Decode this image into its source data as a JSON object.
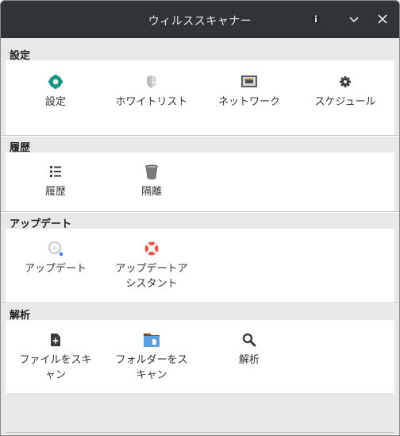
{
  "window": {
    "title": "ウィルススキャナー"
  },
  "sections": {
    "settings": {
      "title": "設定",
      "items": [
        {
          "label": "設定",
          "icon": "shield-gear-icon"
        },
        {
          "label": "ホワイトリスト",
          "icon": "whitelist-shield-icon"
        },
        {
          "label": "ネットワーク",
          "icon": "network-icon"
        },
        {
          "label": "スケジュール",
          "icon": "gear-icon"
        }
      ]
    },
    "history": {
      "title": "履歴",
      "items": [
        {
          "label": "履歴",
          "icon": "list-icon"
        },
        {
          "label": "隔離",
          "icon": "trash-icon"
        }
      ]
    },
    "update": {
      "title": "アップデート",
      "items": [
        {
          "label": "アップデート",
          "icon": "update-icon"
        },
        {
          "label": "アップデートアシスタント",
          "icon": "lifebuoy-icon"
        }
      ]
    },
    "analysis": {
      "title": "解析",
      "items": [
        {
          "label": "ファイルをスキャン",
          "icon": "file-add-icon"
        },
        {
          "label": "フォルダーをスキャン",
          "icon": "folder-icon"
        },
        {
          "label": "解析",
          "icon": "search-icon"
        }
      ]
    }
  },
  "colors": {
    "titlebar": "#303338",
    "accent_teal": "#16937f",
    "lifebuoy_red": "#e35d4e",
    "folder_blue": "#5e9fe0",
    "update_blue": "#3b7ee6"
  }
}
